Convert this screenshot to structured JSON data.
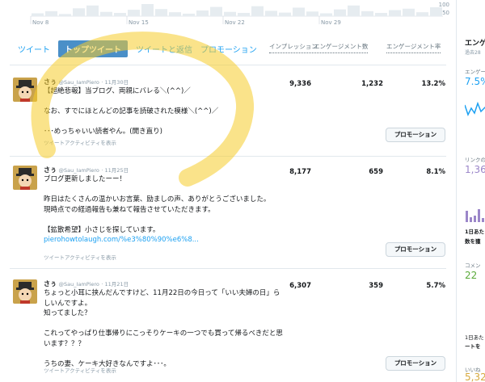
{
  "chart_data": {
    "type": "bar",
    "x_tick_labels": [
      "Nov 8",
      "Nov 15",
      "Nov 22",
      "Nov 29"
    ],
    "y_tick_labels": [
      "100",
      "50"
    ],
    "values": [
      8,
      14,
      6,
      22,
      30,
      12,
      9,
      18,
      34,
      20,
      11,
      7,
      16,
      26,
      12,
      9,
      28,
      15,
      10,
      24,
      13,
      8,
      19,
      30,
      14,
      9,
      17,
      21,
      11,
      25
    ],
    "ylim": [
      0,
      100
    ]
  },
  "tabs": [
    "ツイート",
    "トップツイート",
    "ツイートと返信",
    "プロモーション"
  ],
  "columns": {
    "impressions": "インプレッション",
    "engagements": "エンゲージメント数",
    "rate": "エンゲージメント率"
  },
  "tweets": [
    {
      "name": "さぅ",
      "handle": "@Sau_IamPiero",
      "date": "· 11月30日",
      "text": "【超絶悲報】当ブログ、両親にバレる＼(^^)／\n\nなお、すでにほとんどの記事を読破された模様＼(^^)／\n\n･･･めっちゃいい読者やん。(開き直り)",
      "link": "",
      "impressions": "9,336",
      "engagements": "1,232",
      "rate": "13.2%",
      "activity": "ツイートアクティビティを表示",
      "promote": "プロモーション"
    },
    {
      "name": "さぅ",
      "handle": "@Sau_IamPiero",
      "date": "· 11月25日",
      "text": "ブログ更新しましたーー！\n\n昨日はたくさんの温かいお言葉、励ましの声、ありがとうございました。\n現時点での経過報告も兼ねて報告させていただきます。\n\n【拡散希望】小さじを探しています。",
      "link": "pierohowtolaugh.com/%e3%80%90%e6%8...",
      "impressions": "8,177",
      "engagements": "659",
      "rate": "8.1%",
      "activity": "ツイートアクティビティを表示",
      "promote": "プロモーション"
    },
    {
      "name": "さぅ",
      "handle": "@Sau_IamPiero",
      "date": "· 11月21日",
      "text": "ちょっと小耳に挟んだんですけど、11月22日の今日って「いい夫婦の日」らしいんですよ。\n知ってました？\n\nこれってやっぱり仕事帰りにこっそりケーキの一つでも買って帰るべきだと思います？？？\n\nうちの妻、ケーキ大好きなんですよ･･･。",
      "link": "",
      "impressions": "6,307",
      "engagements": "359",
      "rate": "5.7%",
      "activity": "ツイートアクティビティを表示",
      "promote": "プロモーション"
    }
  ],
  "right_panel": {
    "title": "エンゲ",
    "subtitle": "過去28",
    "eng_label": "エンゲー",
    "eng_rate": "7.5%",
    "link_label": "リンクの",
    "link_value": "1,36",
    "daily_label1": "1日あた",
    "daily_label2": "数を獲",
    "comment_label": "コメン",
    "comment_value": "22",
    "bottom_label1": "1日あた",
    "bottom_label2": "ートを",
    "likes_label": "いいね",
    "likes_value": "5,32"
  },
  "colors": {
    "accent": "#1da1f2",
    "active_tab": "#4a8fc8",
    "purple": "#9b86c9",
    "green": "#5aaa3a",
    "highlighter": "#f5cc2a"
  }
}
